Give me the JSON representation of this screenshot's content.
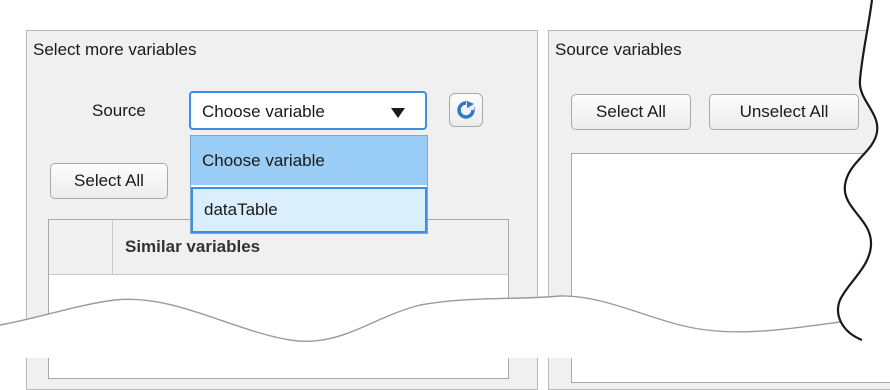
{
  "left_panel": {
    "title": "Select more variables",
    "source_label": "Source",
    "source_dropdown": {
      "value": "Choose variable",
      "options": [
        "Choose variable",
        "dataTable"
      ]
    },
    "refresh_icon": "refresh-icon",
    "select_all_label": "Select All",
    "table": {
      "column_header": "Similar variables"
    }
  },
  "right_panel": {
    "title": "Source variables",
    "select_all_label": "Select All",
    "unselect_all_label": "Unselect All"
  },
  "colors": {
    "panel_bg": "#f0f0f0",
    "accent_border": "#3d8ee6",
    "selected_item": "#99cdf5",
    "hover_item": "#dbeefc"
  }
}
